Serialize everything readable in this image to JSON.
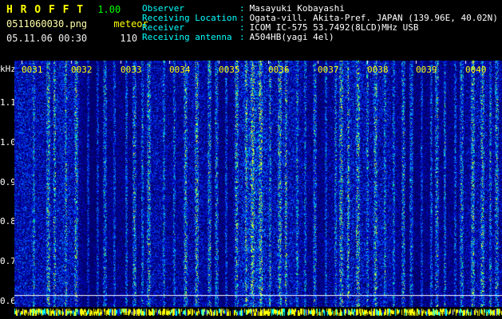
{
  "header": {
    "title": "H R O F F T",
    "version": "1.00",
    "filename": "0511060030.png",
    "mode": "meteor",
    "datetime": "05.11.06 00:30",
    "count": "110",
    "colon": ":",
    "info_rows": [
      {
        "label": "Observer",
        "value": "Masayuki Kobayashi"
      },
      {
        "label": "Receiving Location",
        "value": "Ogata-vill. Akita-Pref. JAPAN (139.96E, 40.02N)"
      },
      {
        "label": "Receiver",
        "value": "ICOM IC-575 53.7492(8LCD)MHz USB"
      },
      {
        "label": "Receiving antenna",
        "value": "A504HB(yagi 4el)"
      }
    ]
  },
  "chart_data": {
    "type": "heatmap",
    "title": "",
    "ylabel": "kHz",
    "y_ticks": [
      "1.1",
      "1.0",
      "0.9",
      "0.8",
      "0.7",
      "0.6"
    ],
    "y_range": [
      0.56,
      1.18
    ],
    "x_ticks": [
      "0031",
      "0032",
      "0033",
      "0034",
      "0035",
      "0036",
      "0037",
      "0038",
      "0039",
      "0040"
    ],
    "x_start": "0030",
    "x_end": "0040",
    "grid": "off",
    "legend": "none",
    "bg_color": "#000080",
    "bands": [
      [
        24,
        2,
        0.3
      ],
      [
        42,
        3,
        0.45
      ],
      [
        50,
        2,
        0.4
      ],
      [
        64,
        2,
        0.3
      ],
      [
        70,
        20,
        0.08
      ],
      [
        77,
        3,
        0.45
      ],
      [
        92,
        2,
        0.3
      ],
      [
        104,
        2,
        0.32
      ],
      [
        113,
        3,
        0.42
      ],
      [
        125,
        2,
        0.3
      ],
      [
        140,
        2,
        0.38
      ],
      [
        150,
        3,
        0.48
      ],
      [
        160,
        2,
        0.33
      ],
      [
        168,
        3,
        0.42
      ],
      [
        187,
        2,
        0.3
      ],
      [
        200,
        2,
        0.33
      ],
      [
        214,
        3,
        0.45
      ],
      [
        222,
        28,
        0.1
      ],
      [
        228,
        3,
        0.48
      ],
      [
        244,
        3,
        0.45
      ],
      [
        253,
        3,
        0.45
      ],
      [
        265,
        2,
        0.33
      ],
      [
        278,
        3,
        0.45
      ],
      [
        290,
        2,
        0.36
      ],
      [
        298,
        3,
        0.45
      ],
      [
        300,
        22,
        0.1
      ],
      [
        308,
        3,
        0.48
      ],
      [
        320,
        2,
        0.32
      ],
      [
        332,
        3,
        0.45
      ],
      [
        340,
        2,
        0.4
      ],
      [
        354,
        2,
        0.3
      ],
      [
        364,
        2,
        0.32
      ],
      [
        376,
        3,
        0.45
      ],
      [
        390,
        2,
        0.3
      ],
      [
        402,
        2,
        0.36
      ],
      [
        409,
        3,
        0.45
      ],
      [
        418,
        2,
        0.4
      ],
      [
        425,
        22,
        0.1
      ],
      [
        430,
        3,
        0.45
      ],
      [
        442,
        2,
        0.3
      ],
      [
        452,
        3,
        0.42
      ],
      [
        464,
        2,
        0.3
      ],
      [
        475,
        2,
        0.32
      ],
      [
        487,
        3,
        0.45
      ],
      [
        497,
        3,
        0.42
      ],
      [
        510,
        2,
        0.3
      ],
      [
        522,
        2,
        0.36
      ],
      [
        529,
        3,
        0.45
      ],
      [
        539,
        2,
        0.4
      ],
      [
        540,
        20,
        0.08
      ],
      [
        552,
        2,
        0.32
      ],
      [
        560,
        3,
        0.42
      ],
      [
        574,
        3,
        0.45
      ],
      [
        586,
        3,
        0.42
      ],
      [
        596,
        2,
        0.35
      ],
      [
        604,
        3,
        0.4
      ]
    ]
  },
  "render": {
    "palette": [
      [
        0.0,
        "#000060"
      ],
      [
        0.14,
        "#0000a0"
      ],
      [
        0.26,
        "#0010d0"
      ],
      [
        0.38,
        "#0038f8"
      ],
      [
        0.5,
        "#0068ff"
      ],
      [
        0.6,
        "#00a0ff"
      ],
      [
        0.7,
        "#00d0e8"
      ],
      [
        0.79,
        "#00e8b0"
      ],
      [
        0.86,
        "#20e070"
      ],
      [
        0.92,
        "#70f040"
      ],
      [
        0.97,
        "#e8ff20"
      ]
    ],
    "noise": {
      "base": 0.27,
      "seed": 51106
    },
    "ticks_x": [
      9,
      71,
      133,
      194,
      256,
      318,
      380,
      442,
      503,
      565
    ],
    "layout": {
      "noise_height": 309,
      "hline_y": 294,
      "strip_y": 311,
      "strip_h": 9
    },
    "strip_colors": {
      "yellow": "#ffff00",
      "cyan": "#00ffff",
      "blue": "#0018c0"
    },
    "tick_color": "#ffffff",
    "hline_color": "#ffffff"
  },
  "colors": {
    "title": "#ffff00",
    "version": "#00ff00",
    "filename": "#ffffa8",
    "mode": "#ffff00",
    "datetime": "#f0f0f0",
    "info_label": "#00ffff",
    "info_value": "#ffffff",
    "time_label": "#ffff00",
    "freq_label": "#ffffff",
    "background": "#000000"
  }
}
